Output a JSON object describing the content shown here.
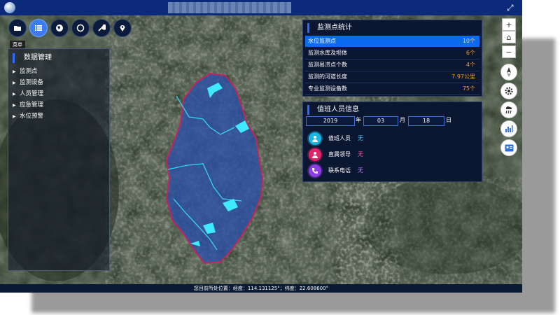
{
  "window": {
    "icons": {
      "logo": "globe-logo-icon",
      "expand": "expand-icon"
    },
    "expand_glyph": "⤢"
  },
  "toolbar": {
    "buttons": [
      {
        "name": "folder-button",
        "icon": "folder-icon"
      },
      {
        "name": "menu-button",
        "icon": "list-icon",
        "active": true
      },
      {
        "name": "layers-button",
        "icon": "globe-icon"
      },
      {
        "name": "circle-select-button",
        "icon": "circle-icon"
      },
      {
        "name": "tools-button",
        "icon": "wrench-icon"
      },
      {
        "name": "locate-button",
        "icon": "map-pin-icon"
      }
    ],
    "tooltip": "菜单"
  },
  "left_panel": {
    "title": "数据管理",
    "items": [
      {
        "label": "监测点"
      },
      {
        "label": "监测设备"
      },
      {
        "label": "人员管理"
      },
      {
        "label": "应急管理"
      },
      {
        "label": "水位预警"
      }
    ]
  },
  "stats_panel": {
    "title": "监测点统计",
    "rows": [
      {
        "label": "水位监测点",
        "value": "10个",
        "selected": true
      },
      {
        "label": "监测水库及坝体",
        "value": "6个"
      },
      {
        "label": "监测易涝点个数",
        "value": "4个"
      },
      {
        "label": "监测的河道长度",
        "value": "7.97公里"
      },
      {
        "label": "专业监测设备数",
        "value": "75个"
      }
    ]
  },
  "duty_panel": {
    "title": "值班人员信息",
    "year": "2019",
    "year_suffix": "年",
    "month": "03",
    "month_suffix": "月",
    "day": "18",
    "day_suffix": "日",
    "people": [
      {
        "label": "值班人员",
        "value": "无",
        "icon": "person-icon",
        "color": "#18b6e0",
        "value_color": "#37c6ff"
      },
      {
        "label": "直属领导",
        "value": "无",
        "icon": "leader-icon",
        "color": "#e0246a",
        "value_color": "#ff4fa0"
      },
      {
        "label": "联系电话",
        "value": "无",
        "icon": "phone-icon",
        "color": "#8d3ee0",
        "value_color": "#c17dff"
      }
    ]
  },
  "map_controls": {
    "zoom_in": "+",
    "home": "⌂",
    "zoom_out": "−",
    "tools": [
      {
        "name": "compass-button",
        "icon": "compass-icon"
      },
      {
        "name": "settings-button",
        "icon": "gear-icon"
      },
      {
        "name": "rain-button",
        "icon": "rain-icon"
      },
      {
        "name": "chart-button",
        "icon": "bar-chart-icon"
      },
      {
        "name": "contact-card-button",
        "icon": "id-card-icon"
      }
    ]
  },
  "status_bar": {
    "prefix": "您目前所处位置：",
    "lng_label": "经度：",
    "lng": "114.131125°",
    "sep": "；",
    "lat_label": "纬度：",
    "lat": "22.608600°"
  },
  "colors": {
    "titlebar": "#0d2a7a",
    "region_fill": "#2a4fa8",
    "region_border": "#c2255c",
    "water": "#36e0ff",
    "selected_row": "#0a6af1",
    "stat_value": "#f7a21b"
  }
}
